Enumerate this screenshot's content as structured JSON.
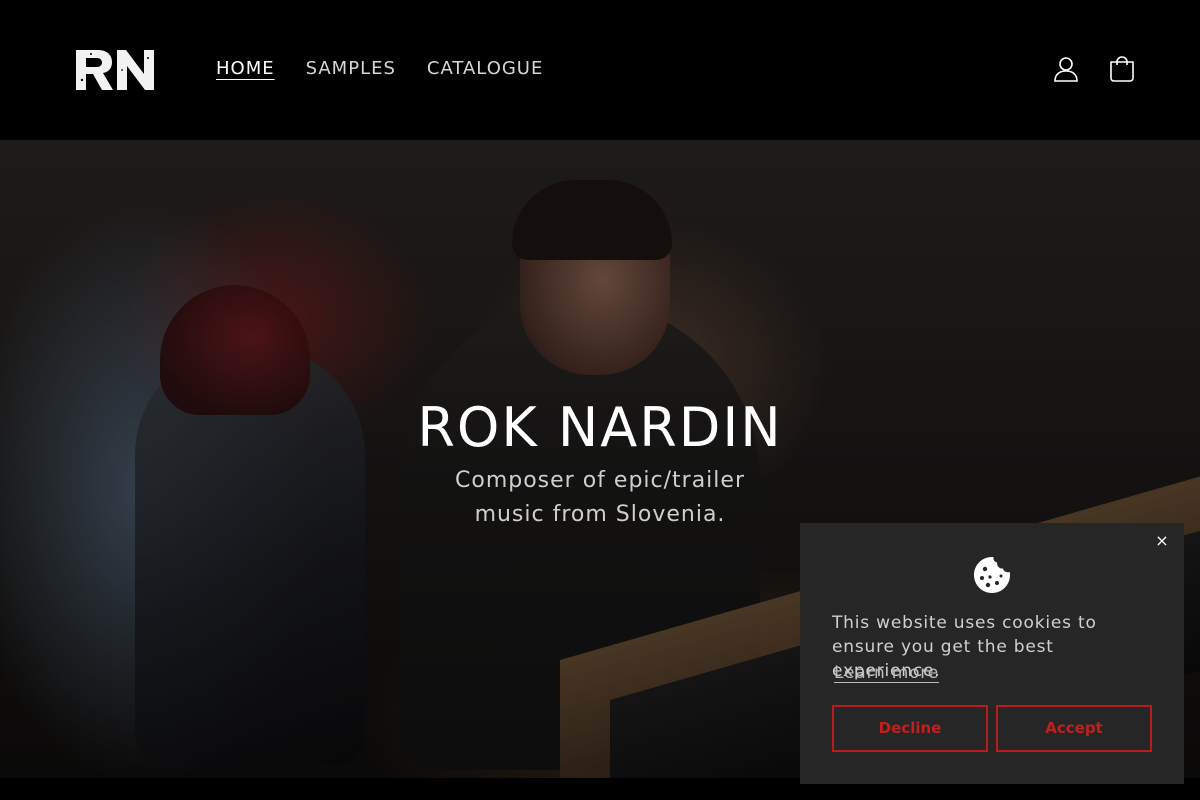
{
  "header": {
    "logo_text": "RN",
    "nav": [
      {
        "label": "HOME",
        "active": true
      },
      {
        "label": "SAMPLES",
        "active": false
      },
      {
        "label": "CATALOGUE",
        "active": false
      }
    ],
    "icons": [
      "account-icon",
      "cart-icon"
    ]
  },
  "hero": {
    "title": "ROK NARDIN",
    "subtitle": "Composer of epic/trailer music from Slovenia."
  },
  "cookie_banner": {
    "close_symbol": "×",
    "icon": "cookie-icon",
    "message": "This website uses cookies to ensure you get the best experience.",
    "learn_more": "Learn more",
    "decline_label": "Decline",
    "accept_label": "Accept",
    "button_color": "#b91c1c"
  },
  "colors": {
    "background": "#000000",
    "popup_background": "#262626",
    "text_primary": "#ffffff"
  }
}
